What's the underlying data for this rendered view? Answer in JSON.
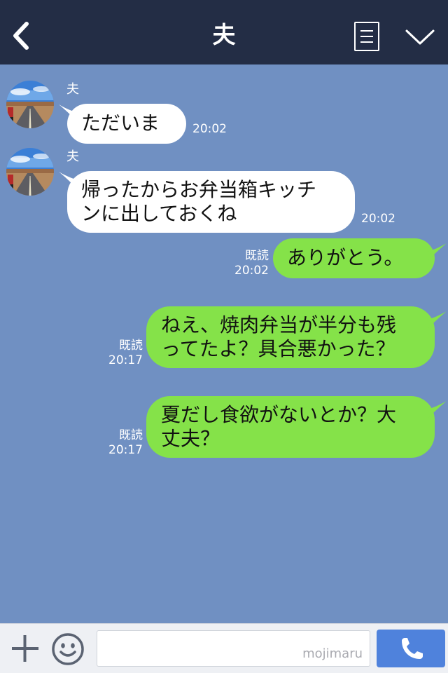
{
  "header": {
    "title": "夫",
    "back_icon": "chevron-left-icon",
    "menu_icon": "note-list-icon",
    "expand_icon": "chevron-down-icon"
  },
  "messages": [
    {
      "direction": "incoming",
      "sender": "夫",
      "text": "ただいま",
      "time": "20:02"
    },
    {
      "direction": "incoming",
      "sender": "夫",
      "lines": [
        "帰ったからお弁当箱キッチ",
        "ンに出しておくね"
      ],
      "time": "20:02"
    },
    {
      "direction": "outgoing",
      "text": "ありがとう。",
      "read": "既読",
      "time": "20:02"
    },
    {
      "direction": "outgoing",
      "lines": [
        "ねえ、焼肉弁当が半分も残",
        "ってたよ？具合悪かった？"
      ],
      "read": "既読",
      "time": "20:17"
    },
    {
      "direction": "outgoing",
      "lines": [
        "夏だし食欲がないとか？大",
        "丈夫？"
      ],
      "read": "既読",
      "time": "20:17"
    }
  ],
  "input": {
    "watermark": "mojimaru",
    "plus_icon": "plus-icon",
    "emoji_icon": "smiley-icon",
    "call_icon": "phone-icon"
  },
  "colors": {
    "header_bg": "#232d45",
    "chat_bg": "#7090c2",
    "incoming_bubble": "#ffffff",
    "outgoing_bubble": "#85e249",
    "call_button": "#4f82dc"
  }
}
